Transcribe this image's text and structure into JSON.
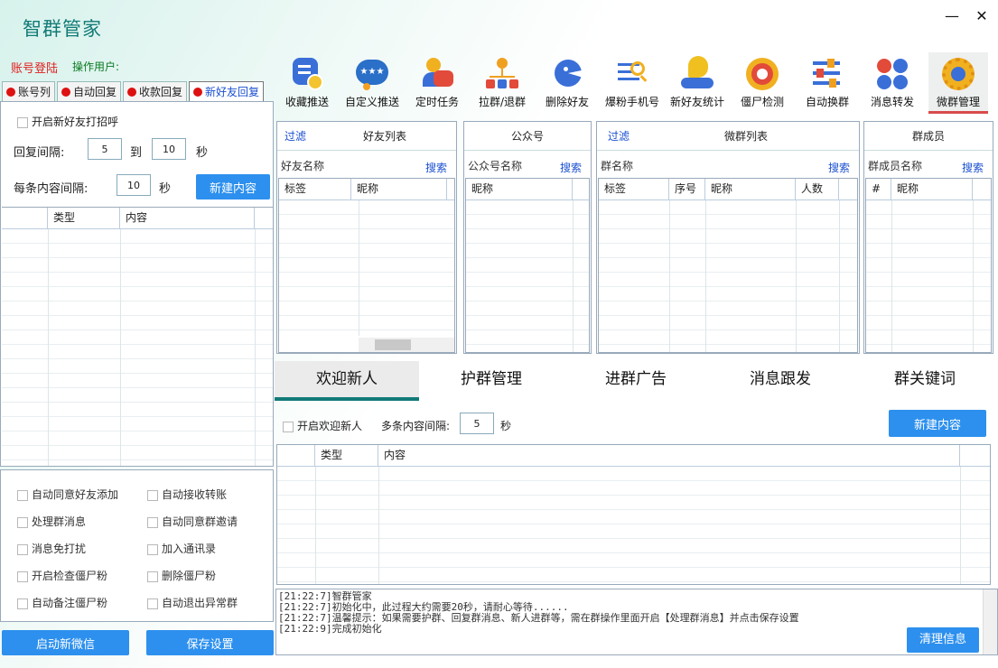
{
  "app": {
    "title": "智群管家",
    "login": "账号登陆",
    "operator": "操作用户:"
  },
  "left_tabs": [
    "账号列",
    "自动回复",
    "收款回复",
    "新好友回复"
  ],
  "left": {
    "greet_label": "开启新好友打招呼",
    "interval_label": "回复间隔:",
    "interval_from": "5",
    "to": "到",
    "interval_to": "10",
    "sec": "秒",
    "each_label": "每条内容间隔:",
    "each_value": "10",
    "each_sec": "秒",
    "new_btn": "新建内容",
    "grid_cols": [
      "类型",
      "内容"
    ]
  },
  "options": [
    "自动同意好友添加",
    "自动接收转账",
    "处理群消息",
    "自动同意群邀请",
    "消息免打扰",
    "加入通讯录",
    "开启检查僵尸粉",
    "删除僵尸粉",
    "自动备注僵尸粉",
    "自动退出异常群"
  ],
  "bottom_buttons": {
    "start": "启动新微信",
    "save": "保存设置"
  },
  "toolbar": [
    {
      "label": "收藏推送",
      "icon": "favorite-push-icon",
      "color": "#3a6fd8"
    },
    {
      "label": "自定义推送",
      "icon": "custom-push-icon",
      "color": "#2a8ad0"
    },
    {
      "label": "定时任务",
      "icon": "scheduled-task-icon",
      "color": "#e24a3a"
    },
    {
      "label": "拉群/退群",
      "icon": "group-tree-icon",
      "color": "#f0a020"
    },
    {
      "label": "删除好友",
      "icon": "delete-friend-icon",
      "color": "#3a6fd8"
    },
    {
      "label": "爆粉手机号",
      "icon": "phone-search-icon",
      "color": "#3a6fd8"
    },
    {
      "label": "新好友统计",
      "icon": "new-friend-stats-icon",
      "color": "#f0c020"
    },
    {
      "label": "僵尸检测",
      "icon": "zombie-detect-icon",
      "color": "#e24a3a"
    },
    {
      "label": "自动换群",
      "icon": "auto-switch-group-icon",
      "color": "#3a6fd8"
    },
    {
      "label": "消息转发",
      "icon": "message-forward-icon",
      "color": "#e24a3a"
    },
    {
      "label": "微群管理",
      "icon": "group-manage-gear-icon",
      "color": "#f0b020"
    }
  ],
  "panes": {
    "friends": {
      "filter": "过滤",
      "title": "好友列表",
      "search_label": "好友名称",
      "search": "搜索",
      "cols": [
        "标签",
        "昵称"
      ]
    },
    "public": {
      "title": "公众号",
      "search_label": "公众号名称",
      "search": "搜索",
      "cols": [
        "昵称"
      ]
    },
    "groups": {
      "filter": "过滤",
      "title": "微群列表",
      "search_label": "群名称",
      "search": "搜索",
      "cols": [
        "标签",
        "序号",
        "昵称",
        "人数"
      ]
    },
    "members": {
      "title": "群成员",
      "search_label": "群成员名称",
      "search": "搜索",
      "cols": [
        "#",
        "昵称"
      ]
    }
  },
  "big_tabs": [
    "欢迎新人",
    "护群管理",
    "进群广告",
    "消息跟发",
    "群关键词"
  ],
  "welcome": {
    "enable": "开启欢迎新人",
    "interval_label": "多条内容间隔:",
    "interval": "5",
    "sec": "秒",
    "new_btn": "新建内容",
    "cols": [
      "类型",
      "内容"
    ]
  },
  "log_lines": [
    "[21:22:7]智群管家",
    "[21:22:7]初始化中，此过程大约需要20秒，请耐心等待......",
    "[21:22:7]温馨提示：如果需要护群、回复群消息、新人进群等，需在群操作里面开启【处理群消息】并点击保存设置",
    "[21:22:9]完成初始化"
  ],
  "clear_btn": "清理信息"
}
